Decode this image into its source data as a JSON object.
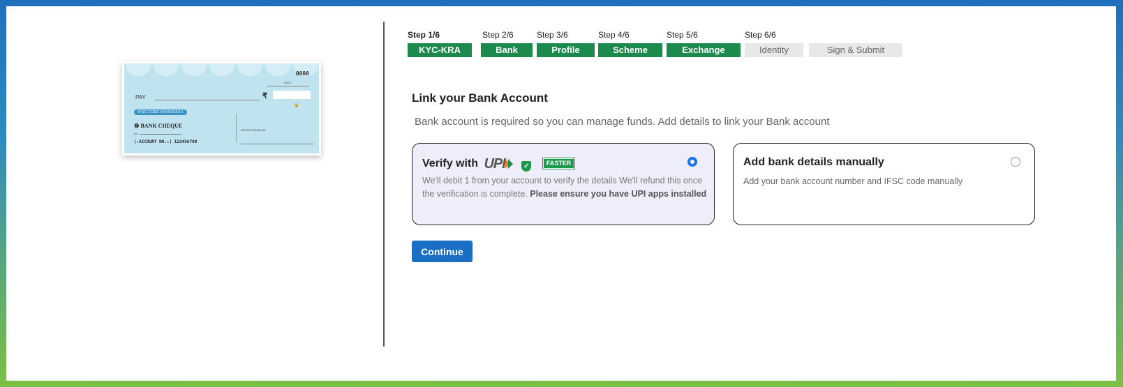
{
  "cheque": {
    "number": "0000",
    "date_label": "DATE",
    "pay_label": "PAY",
    "rupee_symbol": "₹",
    "ifsc_label": "IFSC CODE XXXXXXXXX",
    "bank_name": "BANK CHEQUE",
    "ac_label": "AC",
    "account_label": "|:ACCOUNT NO.:|  123456789",
    "signature_label": "PAYER'S SIGNATURE"
  },
  "stepper": {
    "steps": [
      {
        "label": "Step 1/6",
        "name": "KYC-KRA",
        "state": "done"
      },
      {
        "label": "Step 2/6",
        "name": "Bank",
        "state": "done"
      },
      {
        "label": "Step 3/6",
        "name": "Profile",
        "state": "done"
      },
      {
        "label": "Step 4/6",
        "name": "Scheme",
        "state": "done"
      },
      {
        "label": "Step 5/6",
        "name": "Exchange",
        "state": "done"
      },
      {
        "label": "Step 6/6",
        "name": "Identity",
        "state": "todo"
      },
      {
        "label": "",
        "name": "Sign & Submit",
        "state": "todo"
      }
    ]
  },
  "main": {
    "title": "Link your Bank Account",
    "subtitle": "Bank account is required so you can manage funds. Add details to link your Bank account"
  },
  "options": {
    "upi": {
      "heading": "Verify with",
      "logo_text": "UPI",
      "badge": "FASTER",
      "desc": "We'll debit 1 from your account to verify the details We'll refund this once the verification is complete.",
      "desc_bold": "Please ensure you have UPI apps installed",
      "selected": true
    },
    "manual": {
      "heading": "Add bank details manually",
      "desc": "Add your bank account number and IFSC code manually",
      "selected": false
    }
  },
  "actions": {
    "continue_label": "Continue"
  },
  "colors": {
    "step_done": "#1b8a4c",
    "step_todo": "#e8e8e8",
    "primary": "#1a6fc4",
    "upi_card_bg": "#eeeefa"
  }
}
